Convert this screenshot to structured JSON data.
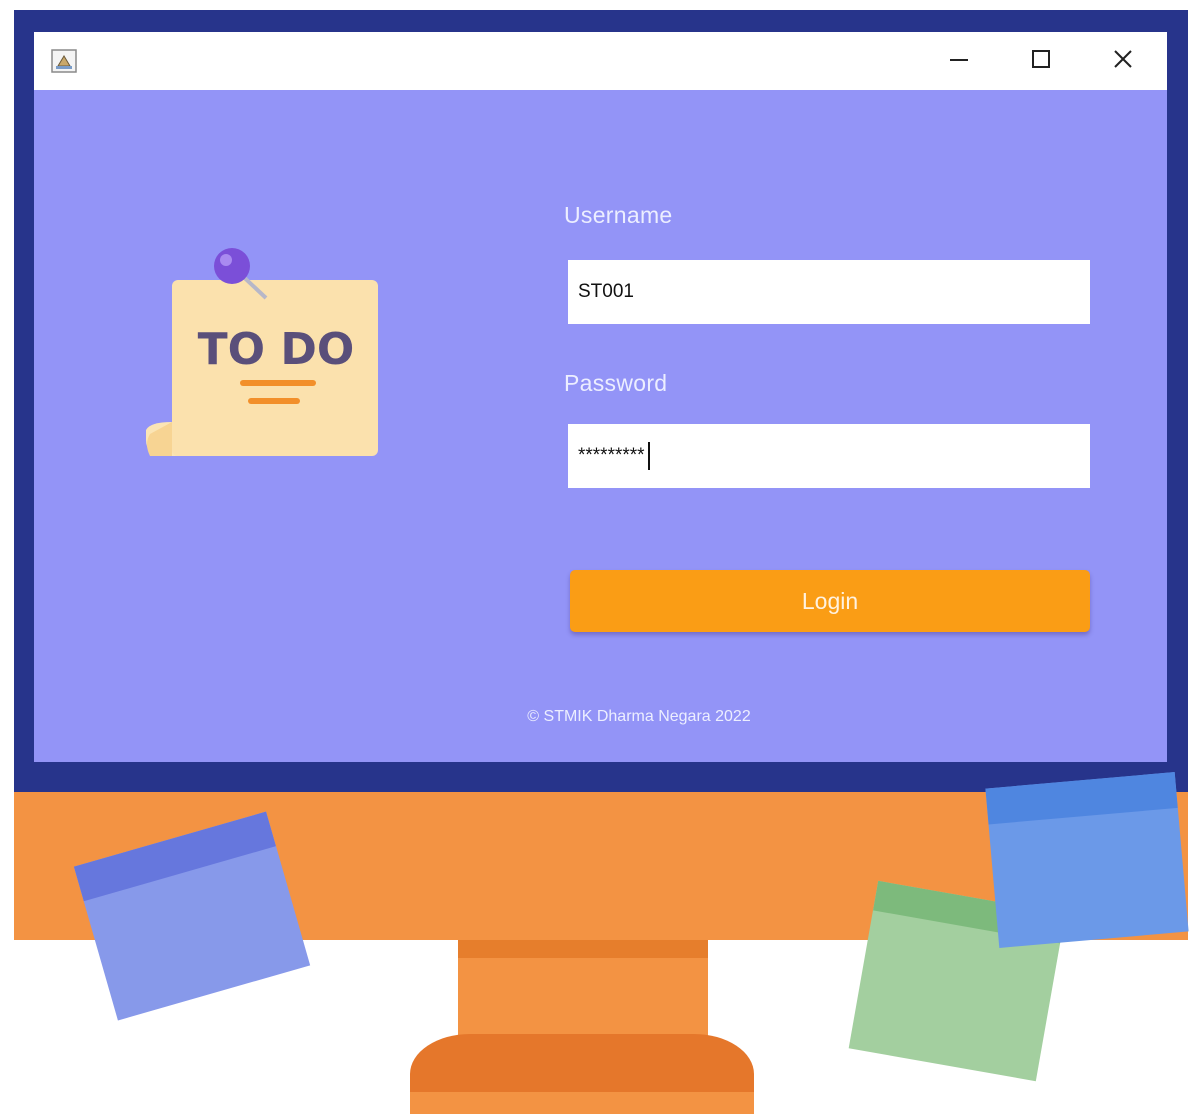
{
  "window": {
    "title_icon": "java-app-icon",
    "controls": {
      "minimize_icon": "minimize-icon",
      "maximize_icon": "maximize-icon",
      "close_icon": "close-icon"
    }
  },
  "illustration": {
    "note_text": "TO DO",
    "icon": "todo-note-icon"
  },
  "login": {
    "username_label": "Username",
    "username_value": "ST001",
    "password_label": "Password",
    "password_value": "*********",
    "button_label": "Login"
  },
  "footer": {
    "copyright": "© STMIK Dharma Negara 2022"
  },
  "colors": {
    "window_bg": "#9394f7",
    "bezel": "#27348b",
    "monitor_body": "#f39343",
    "login_button": "#fa9d15"
  }
}
